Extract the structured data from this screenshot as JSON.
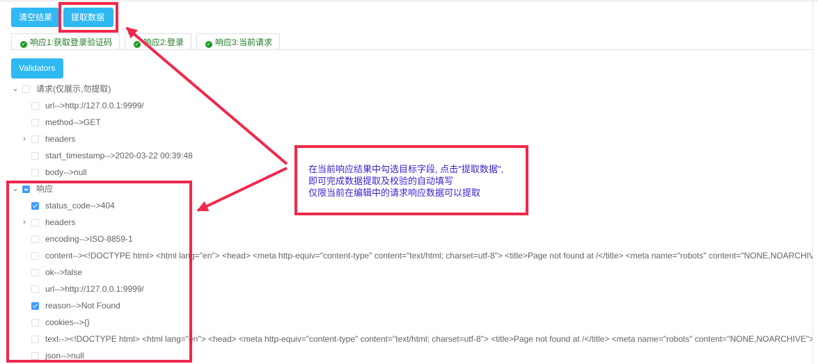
{
  "toolbar": {
    "clear_label": "清空结果",
    "extract_label": "提取数据"
  },
  "tabs": [
    {
      "label": "响应1:获取登录验证码"
    },
    {
      "label": "响应2:登录"
    },
    {
      "label": "响应3:当前请求"
    }
  ],
  "validators_label": "Validators",
  "tree": {
    "request": {
      "label": "请求(仅展示,勿提取)",
      "children": [
        {
          "label": "url-->http://127.0.0.1:9999/"
        },
        {
          "label": "method-->GET"
        },
        {
          "label": "headers"
        },
        {
          "label": "start_timestamp-->2020-03-22 00:39:48"
        },
        {
          "label": "body-->null"
        }
      ]
    },
    "response": {
      "label": "响应",
      "children": [
        {
          "label": "status_code-->404"
        },
        {
          "label": "headers"
        },
        {
          "label": "encoding-->ISO-8859-1"
        },
        {
          "label": "content--><!DOCTYPE html> <html lang=\"en\"> <head> <meta http-equiv=\"content-type\" content=\"text/html; charset=utf-8\"> <title>Page not found at /</title> <meta name=\"robots\" content=\"NONE,NOARCHIVE\">"
        },
        {
          "label": "ok-->false"
        },
        {
          "label": "url-->http://127.0.0.1:9999/"
        },
        {
          "label": "reason-->Not Found"
        },
        {
          "label": "cookies-->{}"
        },
        {
          "label": "text--><!DOCTYPE html> <html lang=\"en\"> <head> <meta http-equiv=\"content-type\" content=\"text/html; charset=utf-8\"> <title>Page not found at /</title> <meta name=\"robots\" content=\"NONE,NOARCHIVE\">"
        },
        {
          "label": "json-->null"
        }
      ]
    }
  },
  "annotation": {
    "line1": "在当前响应结果中勾选目标字段, 点击\"提取数据\",",
    "line2": "即可完成数据提取及校验的自动填写",
    "line3": "仅限当前在编辑中的请求响应数据可以提取"
  },
  "colors": {
    "button": "#2fb8f2",
    "annotation_red": "#f0284c",
    "annotation_text": "#3a1fd0",
    "checkbox_checked": "#409eff",
    "tab_text": "#1f7a23"
  }
}
